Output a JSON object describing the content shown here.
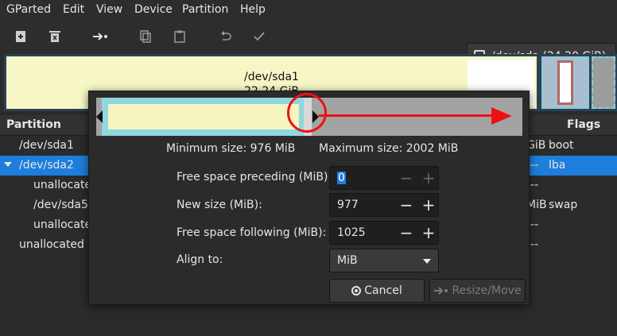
{
  "menu": [
    "GParted",
    "Edit",
    "View",
    "Device",
    "Partition",
    "Help"
  ],
  "toolbar": {
    "icons": [
      "new-icon",
      "delete-icon",
      "resize-move-icon",
      "copy-icon",
      "paste-icon",
      "undo-icon",
      "apply-icon"
    ]
  },
  "device": {
    "label": "/dev/sda (24.20 GiB)"
  },
  "map": {
    "name": "/dev/sda1",
    "size": "22.24 GiB"
  },
  "list": {
    "headers": {
      "partition": "Partition",
      "flags": "Flags"
    },
    "rows": [
      {
        "partition": "/dev/sda1",
        "right": "GiB",
        "flags": "boot"
      },
      {
        "partition": "/dev/sda2",
        "right": "---",
        "flags": "lba"
      },
      {
        "partition": "unallocated",
        "right": "---",
        "flags": ""
      },
      {
        "partition": "/dev/sda5",
        "right": "MiB",
        "flags": "swap"
      },
      {
        "partition": "unallocated",
        "right": "---",
        "flags": ""
      },
      {
        "partition": "unallocated",
        "right": "---",
        "flags": ""
      }
    ]
  },
  "dialog": {
    "min_size": "Minimum size: 976 MiB",
    "max_size": "Maximum size: 2002 MiB",
    "fields": [
      {
        "label": "Free space preceding (MiB):",
        "value": "0"
      },
      {
        "label": "New size (MiB):",
        "value": "977"
      },
      {
        "label": "Free space following (MiB):",
        "value": "1025"
      }
    ],
    "align": {
      "label": "Align to:",
      "value": "MiB"
    },
    "cancel": "Cancel",
    "resize": "Resize/Move"
  },
  "colors": {
    "selection": "#1f7ddb",
    "annotation": "#ee1111",
    "partition_fill": "#f6f4c1",
    "partition_border": "#8fd8de"
  }
}
